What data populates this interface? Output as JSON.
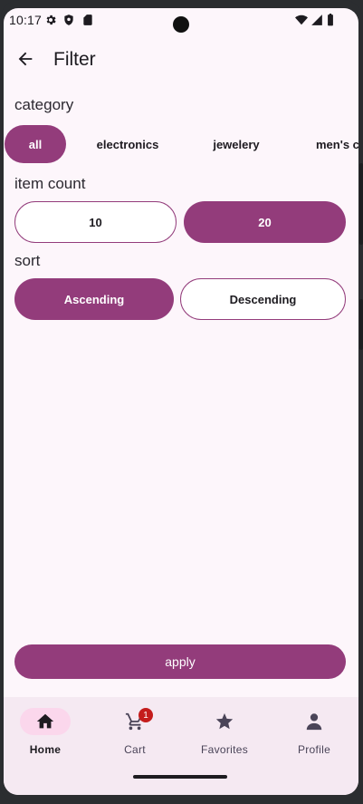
{
  "status_bar": {
    "time": "10:17"
  },
  "top_bar": {
    "title": "Filter"
  },
  "category": {
    "label": "category",
    "chips": [
      {
        "label": "all",
        "selected": true
      },
      {
        "label": "electronics",
        "selected": false
      },
      {
        "label": "jewelery",
        "selected": false
      },
      {
        "label": "men's c",
        "selected": false
      }
    ]
  },
  "item_count": {
    "label": "item count",
    "options": [
      {
        "label": "10",
        "selected": false
      },
      {
        "label": "20",
        "selected": true
      }
    ]
  },
  "sort": {
    "label": "sort",
    "options": [
      {
        "label": "Ascending",
        "selected": true
      },
      {
        "label": "Descending",
        "selected": false
      }
    ]
  },
  "apply_label": "apply",
  "bottom_nav": {
    "items": [
      {
        "label": "Home",
        "icon": "home-icon",
        "active": true
      },
      {
        "label": "Cart",
        "icon": "cart-icon",
        "active": false,
        "badge": "1"
      },
      {
        "label": "Favorites",
        "icon": "star-icon",
        "active": false
      },
      {
        "label": "Profile",
        "icon": "person-icon",
        "active": false
      }
    ]
  },
  "colors": {
    "accent": "#933c7b",
    "background": "#fdf6fb",
    "nav_background": "#f5e9f2",
    "nav_active": "#fbd7ec",
    "badge": "#c41c1c"
  }
}
